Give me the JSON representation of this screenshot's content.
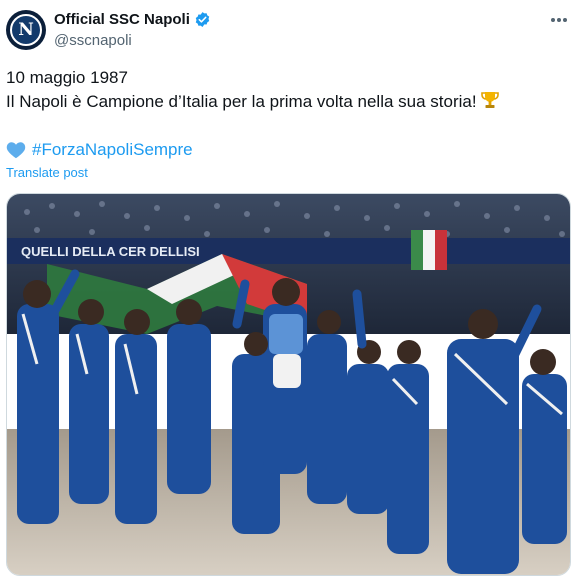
{
  "post": {
    "author": {
      "display_name": "Official SSC Napoli",
      "handle": "@sscnapoli",
      "avatar_letter": "N",
      "verified": true
    },
    "text_lines": [
      "10 maggio 1987",
      "Il Napoli è Campione d’Italia per la prima volta nella sua storia!"
    ],
    "hashtag": "#ForzaNapoliSempre",
    "translate_label": "Translate post",
    "icons": {
      "more": "more-icon",
      "verified": "verified-badge-icon",
      "trophy": "trophy-icon",
      "heart": "blue-heart-icon"
    },
    "photo": {
      "banner_text": "QUELLI DELLA   CER   DELLISI"
    }
  },
  "colors": {
    "link": "#1d9bf0",
    "text_primary": "#0f1419",
    "text_secondary": "#536471",
    "verified": "#1d9bf0",
    "kit_blue": "#1e4f9c"
  }
}
